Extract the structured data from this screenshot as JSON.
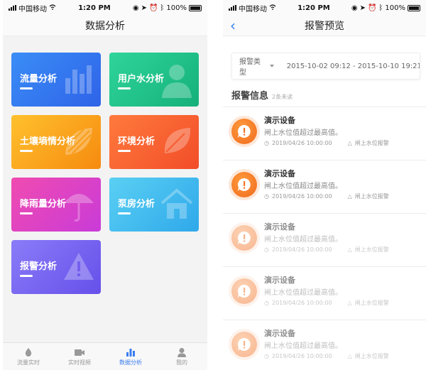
{
  "status_bar": {
    "carrier": "中国移动",
    "time": "1:20 PM",
    "battery": "100%"
  },
  "left": {
    "title": "数据分析",
    "cards": [
      {
        "label": "流量分析",
        "icon": "bar-chart-icon",
        "colors": [
          "#3a8df7",
          "#2f63e8"
        ]
      },
      {
        "label": "用户水分析",
        "icon": "user-icon",
        "colors": [
          "#2fd59a",
          "#15b07a"
        ]
      },
      {
        "label": "土壤墒情分析",
        "icon": "leaf-stripes-icon",
        "colors": [
          "#ffc12d",
          "#f68a10"
        ]
      },
      {
        "label": "环境分析",
        "icon": "leaf-icon",
        "colors": [
          "#ff7a3d",
          "#f24d28"
        ]
      },
      {
        "label": "降雨量分析",
        "icon": "umbrella-icon",
        "colors": [
          "#f04bb0",
          "#c93bd8"
        ]
      },
      {
        "label": "泵房分析",
        "icon": "house-icon",
        "colors": [
          "#5ad0f3",
          "#2fa8ea"
        ]
      },
      {
        "label": "报警分析",
        "icon": "warning-icon",
        "colors": [
          "#8a7cf8",
          "#6650ea"
        ]
      }
    ],
    "tabs": [
      {
        "label": "流量实时",
        "icon": "drop-icon",
        "active": false
      },
      {
        "label": "实时视频",
        "icon": "video-icon",
        "active": false
      },
      {
        "label": "数据分析",
        "icon": "chart-icon",
        "active": true
      },
      {
        "label": "我的",
        "icon": "person-icon",
        "active": false
      }
    ]
  },
  "right": {
    "title": "报警预览",
    "filter": {
      "type_label": "报警类型",
      "date_range": "2015-10-02 09:12 - 2015-10-10 19:21"
    },
    "section": {
      "title": "报警信息",
      "count": "2条未读"
    },
    "alarms": [
      {
        "title": "演示设备",
        "desc": "闸上水位值超过最高值。",
        "time": "2019/04/26 10:00:00",
        "type": "闸上水位报警",
        "unread": true
      },
      {
        "title": "演示设备",
        "desc": "闸上水位值超过最高值。",
        "time": "2019/04/26 10:00:00",
        "type": "闸上水位报警",
        "unread": true
      },
      {
        "title": "演示设备",
        "desc": "闸上水位值超过最高值。",
        "time": "2019/04/26 10:00:00",
        "type": "闸上水位报警",
        "unread": false
      },
      {
        "title": "演示设备",
        "desc": "闸上水位值超过最高值。",
        "time": "2019/04/26 10:00:00",
        "type": "闸上水位报警",
        "unread": false
      },
      {
        "title": "演示设备",
        "desc": "闸上水位值超过最高值。",
        "time": "2019/04/26 10:00:00",
        "type": "闸上水位报警",
        "unread": false
      }
    ]
  }
}
